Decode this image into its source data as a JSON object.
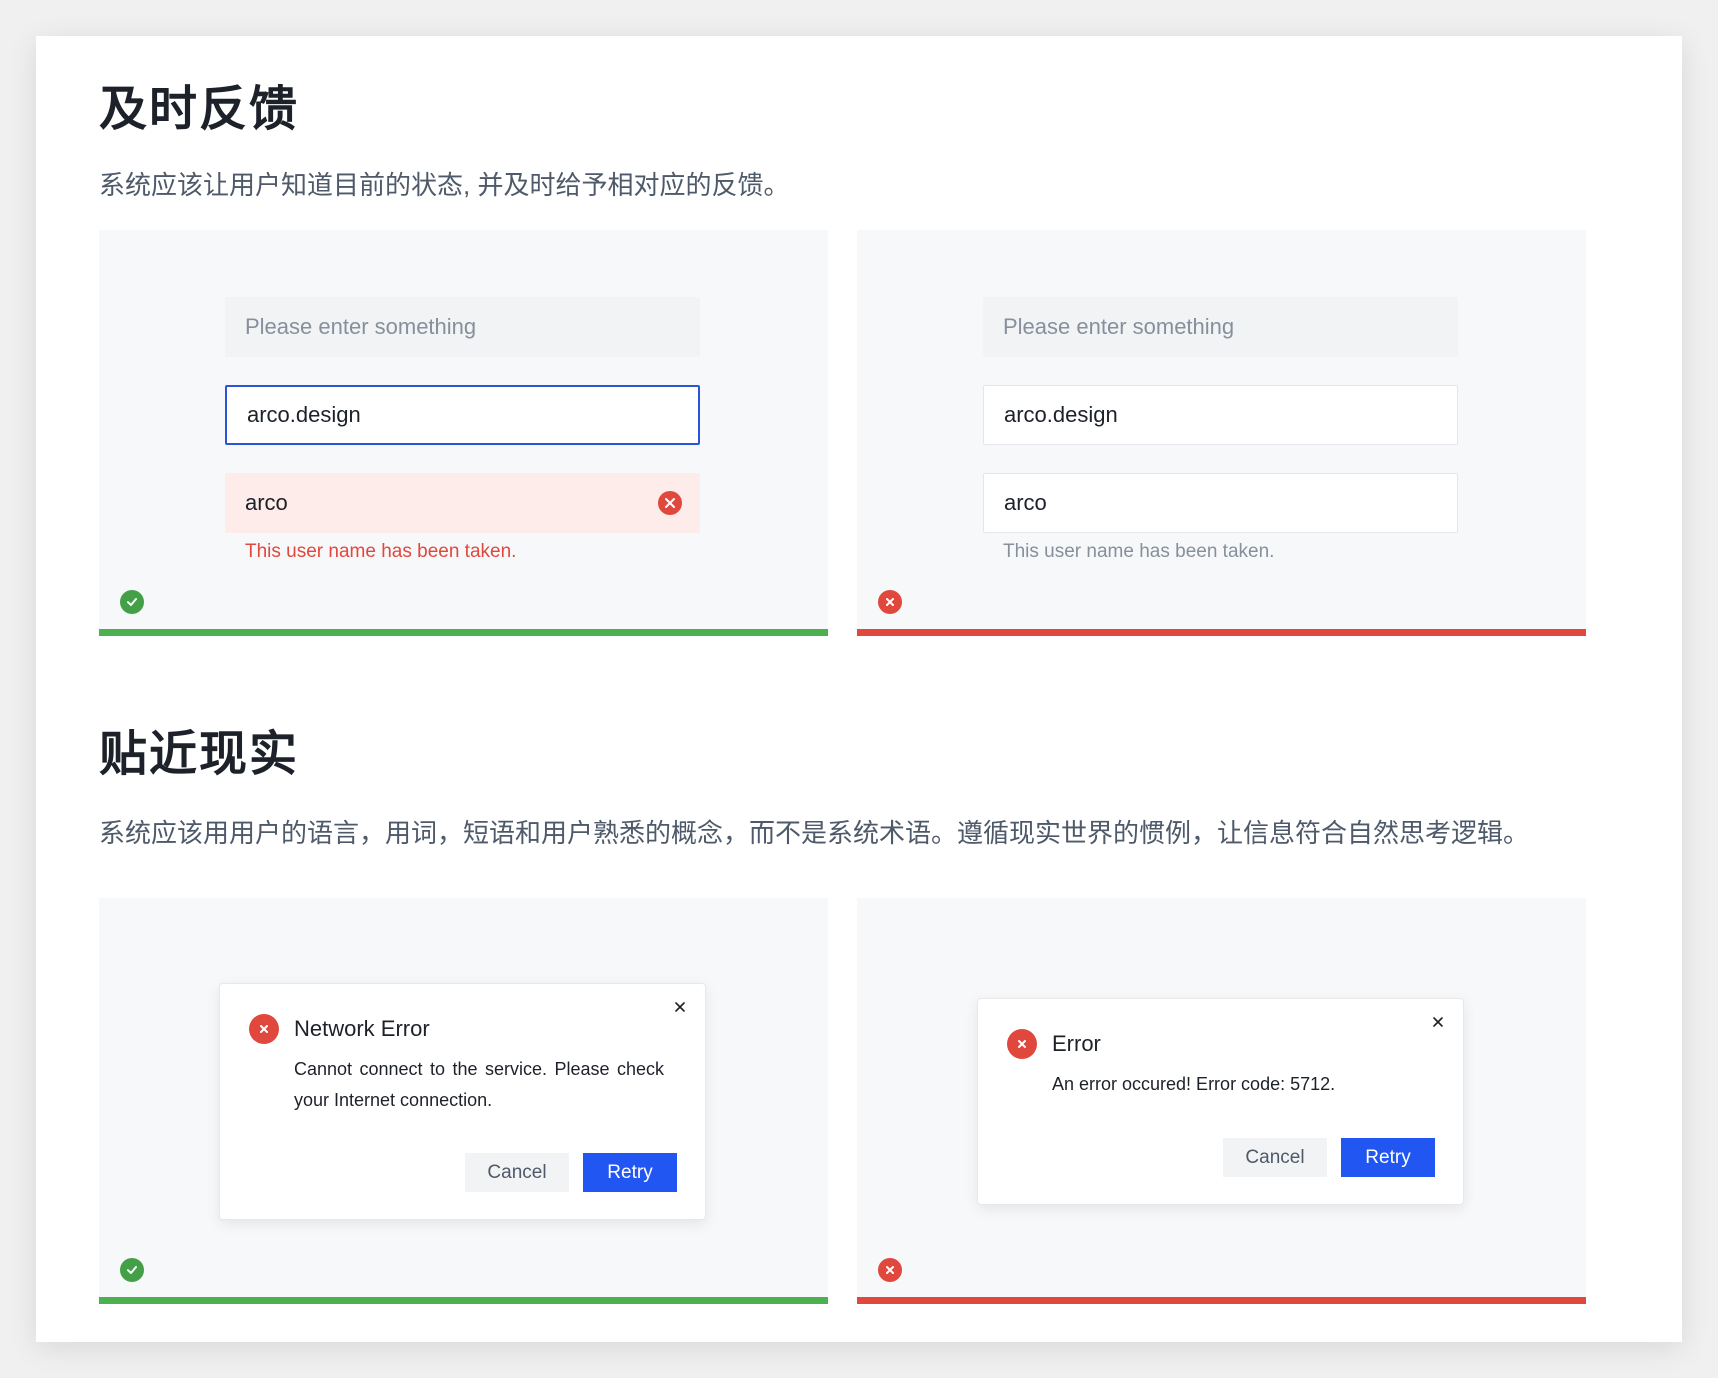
{
  "section1": {
    "title": "及时反馈",
    "description": "系统应该让用户知道目前的状态, 并及时给予相对应的反馈。",
    "good_example": {
      "placeholder": "Please enter something",
      "focused_value": "arco.design",
      "error_value": "arco",
      "helper_text": "This user name has been taken."
    },
    "bad_example": {
      "placeholder": "Please enter something",
      "value_1": "arco.design",
      "value_2": "arco",
      "helper_text": "This user name has been taken."
    }
  },
  "section2": {
    "title": "贴近现实",
    "description": "系统应该用用户的语言，用词，短语和用户熟悉的概念，而不是系统术语。遵循现实世界的惯例，让信息符合自然思考逻辑。",
    "good_example": {
      "modal_title": "Network Error",
      "modal_body": "Cannot connect to the service. Please check your Internet connection.",
      "cancel_label": "Cancel",
      "retry_label": "Retry"
    },
    "bad_example": {
      "modal_title": "Error",
      "modal_body": "An error occured! Error code: 5712.",
      "cancel_label": "Cancel",
      "retry_label": "Retry"
    }
  },
  "icons": {
    "good": "check-circle-icon",
    "bad": "close-circle-icon",
    "clear": "clear-icon",
    "close": "close-icon"
  },
  "colors": {
    "good": "#4caf50",
    "bad": "#e0483e",
    "primary": "#2256f2",
    "focus_border": "#2b55d6"
  }
}
